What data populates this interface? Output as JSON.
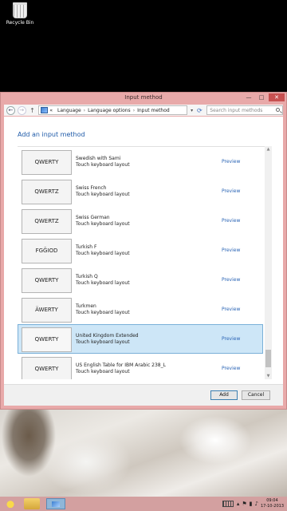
{
  "desktop": {
    "recycle_bin_label": "Recycle Bin"
  },
  "window": {
    "title": "Input method",
    "controls": {
      "minimize": "—",
      "maximize": "□",
      "close": "✕"
    },
    "breadcrumb": [
      "Language",
      "Language options",
      "Input method"
    ],
    "breadcrumb_prefix": "«",
    "search_placeholder": "Search input methods"
  },
  "main": {
    "heading": "Add an input method",
    "preview_label": "Preview",
    "items": [
      {
        "key": "QWERTY",
        "name": "Swedish with Sami",
        "type": "Touch keyboard layout",
        "selected": false
      },
      {
        "key": "QWERTZ",
        "name": "Swiss French",
        "type": "Touch keyboard layout",
        "selected": false
      },
      {
        "key": "QWERTZ",
        "name": "Swiss German",
        "type": "Touch keyboard layout",
        "selected": false
      },
      {
        "key": "FGĞIOD",
        "name": "Turkish F",
        "type": "Touch keyboard layout",
        "selected": false
      },
      {
        "key": "QWERTY",
        "name": "Turkish Q",
        "type": "Touch keyboard layout",
        "selected": false
      },
      {
        "key": "ÄWERTY",
        "name": "Turkmen",
        "type": "Touch keyboard layout",
        "selected": false
      },
      {
        "key": "QWERTY",
        "name": "United Kingdom Extended",
        "type": "Touch keyboard layout",
        "selected": true
      },
      {
        "key": "QWERTY",
        "name": "US English Table for IBM Arabic 238_L",
        "type": "Touch keyboard layout",
        "selected": false
      }
    ]
  },
  "footer": {
    "add_label": "Add",
    "cancel_label": "Cancel"
  },
  "taskbar": {
    "time": "09:04",
    "date": "17-10-2013"
  }
}
